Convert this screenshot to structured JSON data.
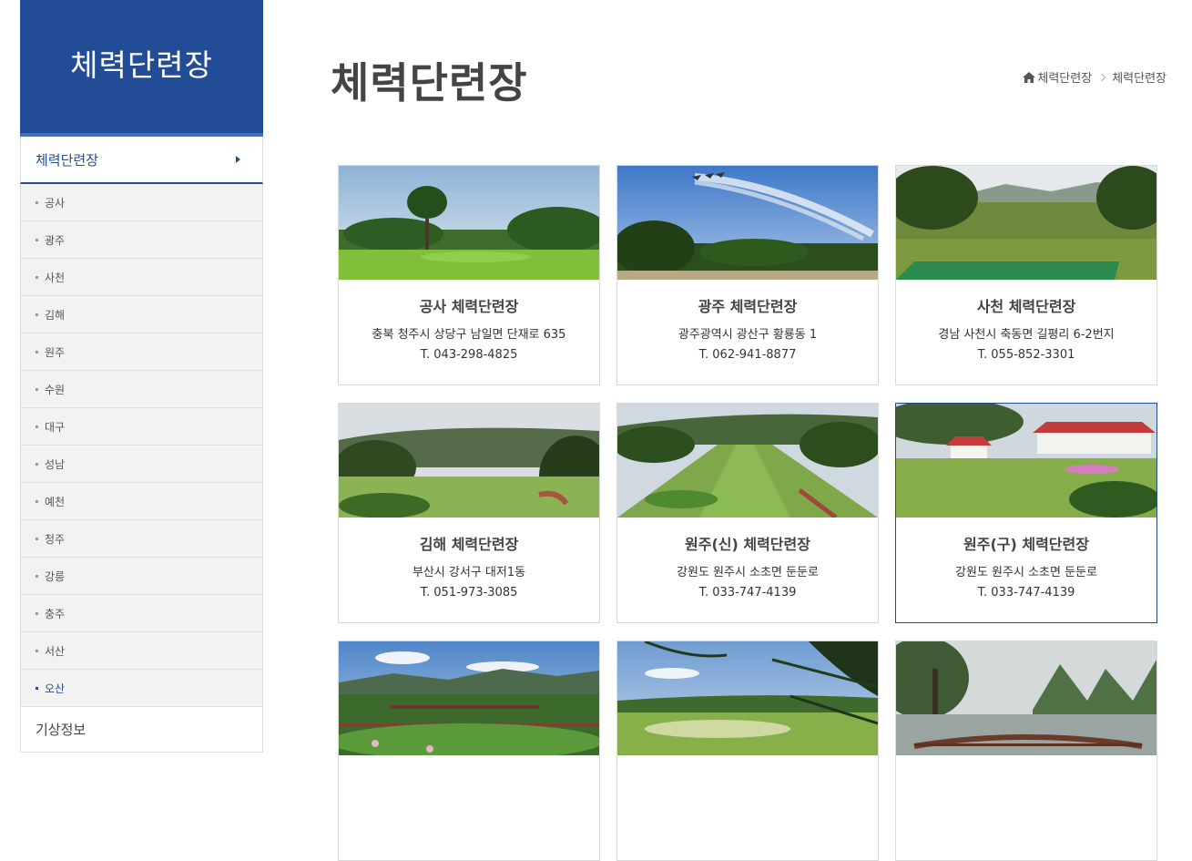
{
  "sidebar": {
    "title": "체력단련장",
    "active_item": "체력단련장",
    "sub_items": [
      "공사",
      "광주",
      "사천",
      "김해",
      "원주",
      "수원",
      "대구",
      "성남",
      "예천",
      "청주",
      "강릉",
      "충주",
      "서산",
      "오산"
    ],
    "current_sub": "오산",
    "other_item": "기상정보"
  },
  "page": {
    "title": "체력단련장"
  },
  "breadcrumb": {
    "home_icon": "home-icon",
    "items": [
      "체력단련장",
      "체력단련장"
    ]
  },
  "cards": [
    {
      "name": "공사 체력단련장",
      "address": "충북 청주시 상당구 남일면 단재로 635",
      "tel": "T. 043-298-4825"
    },
    {
      "name": "광주 체력단련장",
      "address": "광주광역시 광산구 황룡동 1",
      "tel": "T. 062-941-8877"
    },
    {
      "name": "사천 체력단련장",
      "address": "경남 사천시 축동면 길평리 6-2번지",
      "tel": "T. 055-852-3301"
    },
    {
      "name": "김해 체력단련장",
      "address": "부산시 강서구 대저1동",
      "tel": "T. 051-973-3085"
    },
    {
      "name": "원주(신) 체력단련장",
      "address": "강원도 원주시 소초면 둔둔로",
      "tel": "T. 033-747-4139"
    },
    {
      "name": "원주(구) 체력단련장",
      "address": "강원도 원주시 소초면 둔둔로",
      "tel": "T. 033-747-4139"
    },
    {
      "name": "",
      "address": "",
      "tel": ""
    },
    {
      "name": "",
      "address": "",
      "tel": ""
    },
    {
      "name": "",
      "address": "",
      "tel": ""
    }
  ],
  "colors": {
    "brand_blue": "#224d96",
    "accent_blue": "#3d73c2"
  }
}
